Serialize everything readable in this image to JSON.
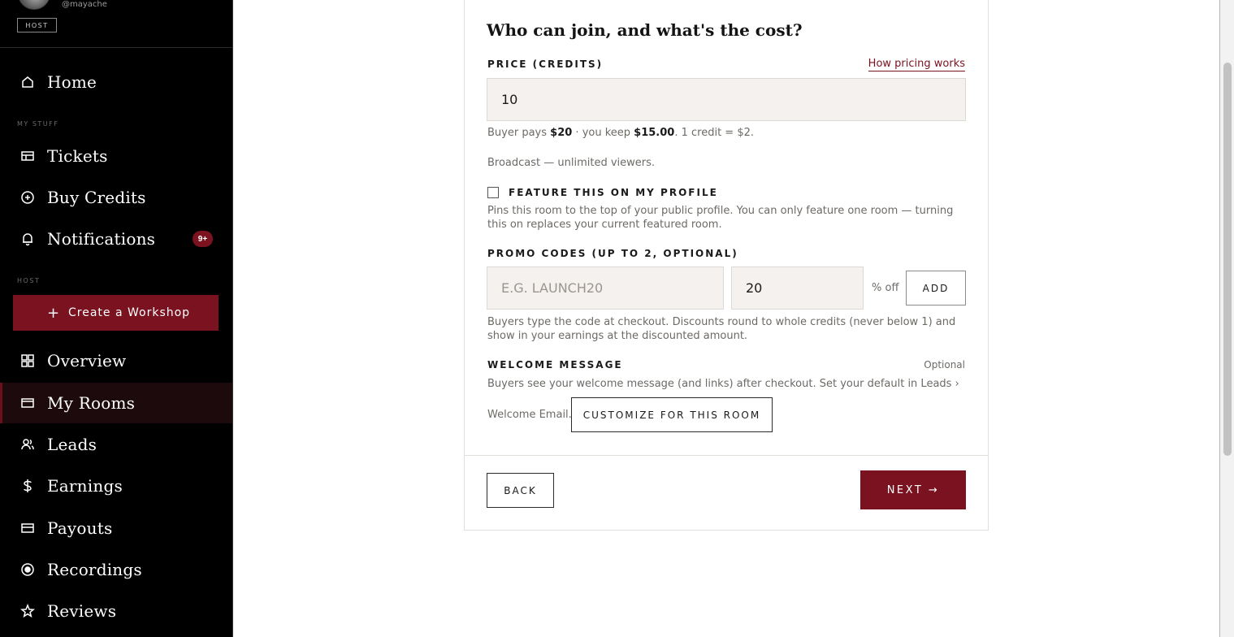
{
  "sidebar": {
    "handle": "@mayache",
    "role_badge": "HOST",
    "section_my_stuff": "MY STUFF",
    "section_host": "HOST",
    "create_button": "Create a Workshop",
    "items": [
      {
        "label": "Home",
        "icon": "home-icon"
      },
      {
        "label": "Tickets",
        "icon": "ticket-icon"
      },
      {
        "label": "Buy Credits",
        "icon": "plus-circle-icon"
      },
      {
        "label": "Notifications",
        "icon": "bell-icon",
        "badge": "9+"
      },
      {
        "label": "Overview",
        "icon": "grid-icon"
      },
      {
        "label": "My Rooms",
        "icon": "window-icon",
        "active": true
      },
      {
        "label": "Leads",
        "icon": "users-icon"
      },
      {
        "label": "Earnings",
        "icon": "dollar-icon"
      },
      {
        "label": "Payouts",
        "icon": "card-icon"
      },
      {
        "label": "Recordings",
        "icon": "record-icon"
      },
      {
        "label": "Reviews",
        "icon": "star-icon"
      }
    ]
  },
  "form": {
    "title": "Who can join, and what's the cost?",
    "price_label": "PRICE (CREDITS)",
    "pricing_link": "How pricing works",
    "price_value": "10",
    "price_help": {
      "prefix": "Buyer pays ",
      "buyer_pays": "$20",
      "middle": " · you keep ",
      "you_keep": "$15.00",
      "suffix": ". 1 credit = $2."
    },
    "broadcast_note": "Broadcast — unlimited viewers.",
    "feature_label": "FEATURE THIS ON MY PROFILE",
    "feature_checked": false,
    "feature_help": "Pins this room to the top of your public profile. You can only feature one room — turning this on replaces your current featured room.",
    "promo_label": "PROMO CODES (UP TO 2, OPTIONAL)",
    "promo_code_placeholder": "E.G. LAUNCH20",
    "promo_percent_value": "20",
    "percent_off_label": "% off",
    "add_button": "ADD",
    "promo_help": "Buyers type the code at checkout. Discounts round to whole credits (never below 1) and show in your earnings at the discounted amount.",
    "welcome_label": "WELCOME MESSAGE",
    "welcome_optional": "Optional",
    "welcome_help_line1": "Buyers see your welcome message (and links) after checkout. Set your default in Leads ›",
    "welcome_help_line2": "Welcome Email.",
    "customize_button": "CUSTOMIZE FOR THIS ROOM",
    "back_button": "BACK",
    "next_button": "NEXT →"
  },
  "colors": {
    "accent": "#7a1220",
    "sidebar_bg": "#000000",
    "input_bg": "#f4f1ee"
  }
}
